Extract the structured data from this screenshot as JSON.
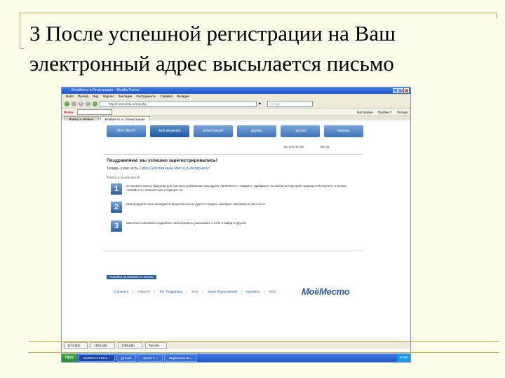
{
  "slide": {
    "title_line1": "3 После успешной регистрации на Ваш",
    "title_line2": "электронный адрес высылается письмо"
  },
  "browser": {
    "window_title": "МоеМесто в Регистрация – Mozilla Firefox",
    "menu": [
      "Файл",
      "Правка",
      "Вид",
      "Журнал",
      "Закладки",
      "Инструменты",
      "Справка",
      "Вкладки"
    ],
    "url": "http://moemesto.ru/reg.php",
    "search_placeholder": "Google",
    "yandex_logo": "Яndex",
    "yandex_right": [
      "Настройки",
      "Пробки 7",
      "Погода"
    ],
    "tabs": [
      "Яndex.ru (Яndex)",
      "МоёМесто.ru | Регистрация"
    ],
    "active_tab_index": 1
  },
  "site": {
    "nav": [
      "Моё Место",
      "моё вещание",
      "регистрация",
      "друзья",
      "группы",
      "помощь"
    ],
    "active_nav_index": 1,
    "user": "вы вошли как",
    "logout": "выход",
    "congrats": "Поздравляем: вы успешно зарегистрировались!",
    "subtitle_prefix": "Теперь у вас есть ",
    "subtitle_link": "Своё Собственное Место в Интернете!",
    "small_hint": "Теперь в вашем месте",
    "steps": [
      {
        "num": "1",
        "text": "Установите кнопку браузера для быстрого добавления закладок в «МоёМесто». Нажмите «Добавить» на любой интересной странице в Интернете, и кнопка «МоёМесто» поможет вам сохранить её."
      },
      {
        "num": "2",
        "text": "Импортируйте свои закладки из браузера или из другого сервиса закладок, например из del.icio.us."
      },
      {
        "num": "3",
        "text": "Заполните как можно подробнее свой профиль, расскажите о себе и найдите друзей."
      }
    ],
    "go_button": "Перейти на МоёМесто сейчас",
    "footer": [
      "О проекте",
      "Новости",
      "Тех. Поддержка",
      "Блог",
      "Книга Предложений",
      "Контакты",
      "RSS"
    ],
    "brand": "МоёМесто"
  },
  "downloads": [
    "1172.php",
    "1182.php",
    "1299.php",
    "Top.doc"
  ],
  "taskbar": {
    "start": "Пуск",
    "tasks": [
      "МоёМесто в Реги...",
      "рутьюб",
      "проект 2 ...",
      "Выражения ма..."
    ],
    "active_task_index": 0,
    "clock": "10:56"
  }
}
